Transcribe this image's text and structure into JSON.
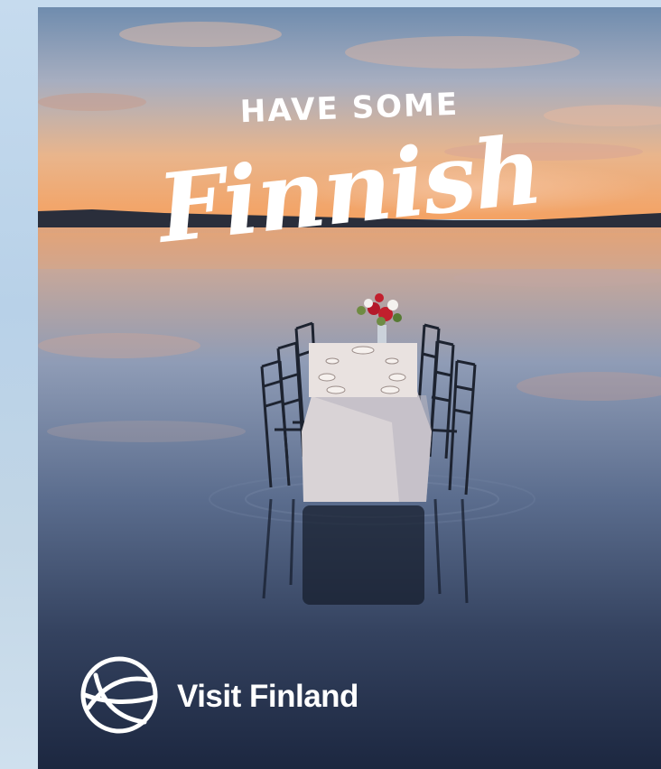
{
  "poster": {
    "headline_line1": "HAVE SOME",
    "headline_line2": "Finnish",
    "brand_name": "Visit Finland"
  },
  "icons": {
    "logo": "visit-finland-logo-icon"
  },
  "colors": {
    "sky_top": "#5d7ea3",
    "sky_horizon": "#f0a86a",
    "water_deep": "#233149",
    "text": "#ffffff"
  }
}
